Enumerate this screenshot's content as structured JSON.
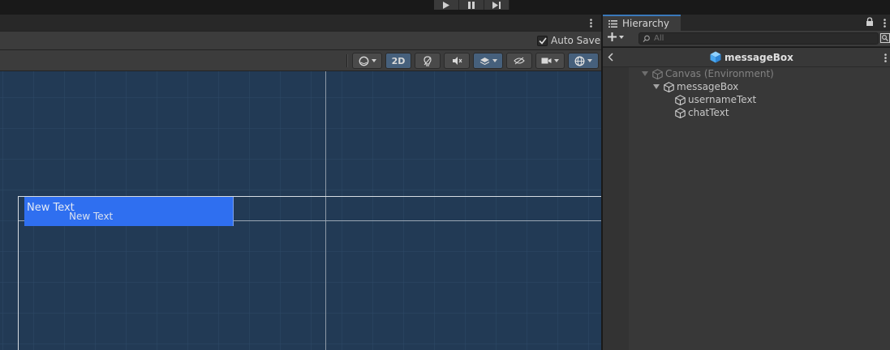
{
  "playbar": {
    "play_icon": "play-icon",
    "pause_icon": "pause-icon",
    "step_icon": "step-icon"
  },
  "scene": {
    "auto_save_label": "Auto Save",
    "auto_save_checked": true,
    "toolbar": {
      "draw_mode_icon": "shading-sphere-icon",
      "mode_2d_label": "2D",
      "mode_2d_active": true,
      "lighting_icon": "light-bulb-icon",
      "audio_icon": "audio-mute-icon",
      "effects_icon": "effects-layers-icon",
      "visibility_icon": "eye-slash-icon",
      "camera_icon": "camera-icon",
      "gizmos_icon": "gizmos-globe-icon"
    },
    "objects": {
      "text_1": "New Text",
      "text_2": "New Text"
    },
    "colors": {
      "background": "#223a55",
      "selection": "#2f6ff0"
    }
  },
  "hierarchy": {
    "tab_label": "Hierarchy",
    "search_placeholder": "All",
    "prefab_name": "messageBox",
    "tree": [
      {
        "label": "Canvas (Environment)",
        "depth": 0,
        "expanded": true,
        "dim": true
      },
      {
        "label": "messageBox",
        "depth": 1,
        "expanded": true,
        "dim": false
      },
      {
        "label": "usernameText",
        "depth": 2,
        "expanded": false,
        "dim": false
      },
      {
        "label": "chatText",
        "depth": 2,
        "expanded": false,
        "dim": false
      }
    ]
  }
}
